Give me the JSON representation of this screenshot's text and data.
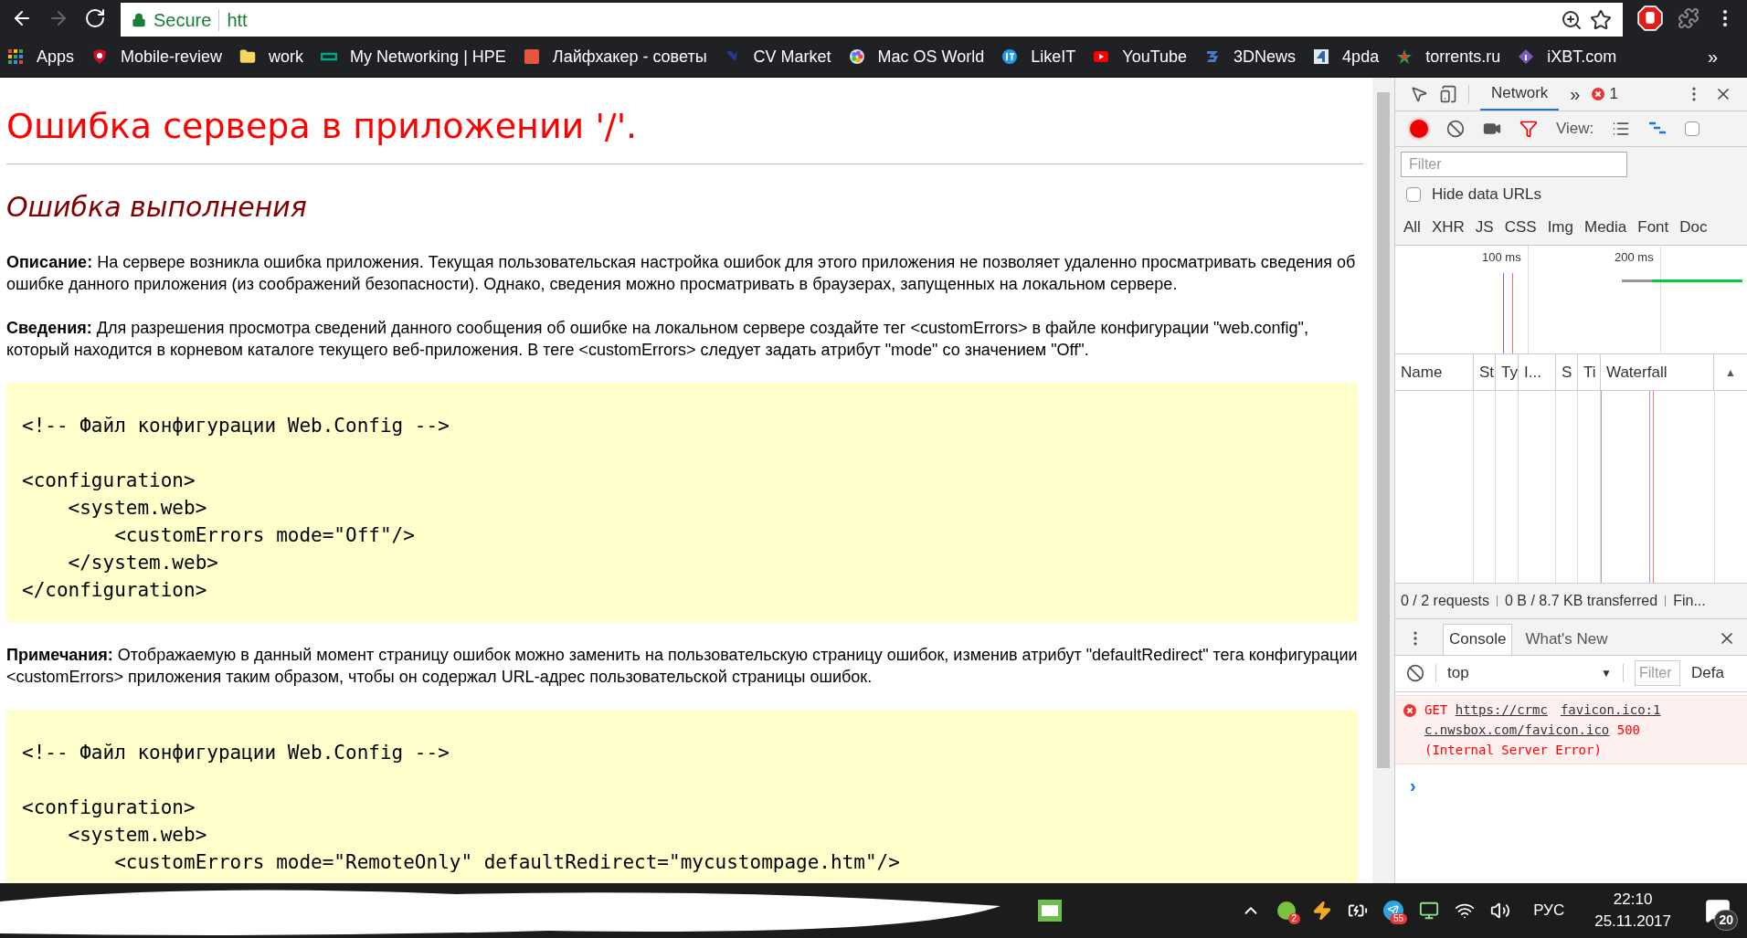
{
  "browser": {
    "secure_label": "Secure",
    "url": "htt",
    "bookmarks": [
      "Apps",
      "Mobile-review",
      "work",
      "My Networking | HPE",
      "Лайфхакер - советы",
      "CV Market",
      "Mac OS World",
      "LikeIT",
      "YouTube",
      "3DNews",
      "4pda",
      "torrents.ru",
      "iXBT.com"
    ],
    "more_bookmarks": "»"
  },
  "page": {
    "title": "Ошибка сервера в приложении '/'.",
    "subtitle": "Ошибка выполнения",
    "paragraphs": [
      {
        "label": "Описание:",
        "text": "На сервере возникла ошибка приложения. Текущая пользовательская настройка ошибок для этого приложения не позволяет удаленно просматривать сведения об ошибке данного приложения (из соображений безопасности). Однако, сведения можно просматривать в браузерах, запущенных на локальном сервере."
      },
      {
        "label": "Сведения:",
        "text": "Для разрешения просмотра сведений данного сообщения об ошибке на локальном сервере создайте тег <customErrors> в файле конфигурации \"web.config\", который находится в корневом каталоге текущего веб-приложения. В теге <customErrors> следует задать атрибут \"mode\" со значением \"Off\"."
      }
    ],
    "code_1": [
      [
        "<!-- Файл конфигурации Web.Config -->"
      ],
      [
        "<configuration>",
        "    <system.web>",
        "        <customErrors mode=\"Off\"/>",
        "    </system.web>",
        "</configuration>"
      ]
    ],
    "note": {
      "label": "Примечания:",
      "text": "Отображаемую в данный момент страницу ошибок можно заменить на пользовательскую страницу ошибок, изменив атрибут \"defaultRedirect\" тега конфигурации <customErrors> приложения таким образом, чтобы он содержал URL-адрес пользовательской страницы ошибок."
    },
    "code_2": [
      [
        "<!-- Файл конфигурации Web.Config -->"
      ],
      [
        "<configuration>",
        "    <system.web>",
        "        <customErrors mode=\"RemoteOnly\" defaultRedirect=\"mycustompage.htm\"/>"
      ]
    ]
  },
  "devtools": {
    "tabs": [
      {
        "label": "Network",
        "selected": true
      }
    ],
    "more_tabs": "»",
    "error_count": "1",
    "recording": true,
    "view_label": "View:",
    "screenshot_checkbox": {
      "checked": false
    },
    "filter_placeholder": "Filter",
    "hide_data_urls": {
      "label": "Hide data URLs",
      "checked": false
    },
    "type_filters": [
      {
        "label": "All",
        "selected": false
      },
      {
        "label": "XHR",
        "selected": false
      },
      {
        "label": "JS",
        "selected": false
      },
      {
        "label": "CSS",
        "selected": false
      },
      {
        "label": "Img",
        "selected": false
      },
      {
        "label": "Media",
        "selected": false
      },
      {
        "label": "Font",
        "selected": false
      },
      {
        "label": "Doc",
        "selected": false
      }
    ],
    "overview_ticks": [
      "100 ms",
      "200 ms"
    ],
    "columns": [
      "Name",
      "St",
      "Ty",
      "I...",
      "S",
      "Ti",
      "Waterfall"
    ],
    "sort_indicator": "▲",
    "status": [
      "0 / 2 requests",
      "0 B / 8.7 KB transferred",
      "Fin..."
    ],
    "drawer_tabs": [
      {
        "label": "Console",
        "selected": true
      },
      {
        "label": "What's New",
        "selected": false
      }
    ],
    "context": "top",
    "context_arrow": "▼",
    "console_filter_placeholder": "Filter",
    "levels": "Defa",
    "messages": [
      {
        "method": "GET",
        "url_part_1": "https://crmc",
        "url_part_2": "c.nwsbox.com/favicon.ico",
        "code": "500",
        "reason": "(Internal Server Error)",
        "source": "favicon.ico:1"
      }
    ],
    "prompt": "›"
  },
  "taskbar": {
    "chat_badge": "2",
    "telegram_badge": "55",
    "language": "РУС",
    "time": "22:10",
    "date": "25.11.2017",
    "notifications": "20"
  }
}
